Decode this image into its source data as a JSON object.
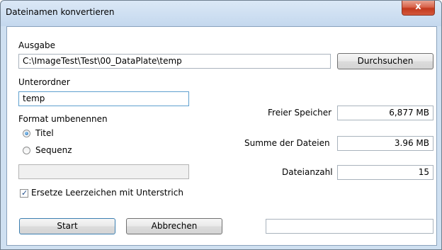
{
  "window": {
    "title": "Dateinamen konvertieren",
    "close_glyph": "x"
  },
  "output": {
    "label": "Ausgabe",
    "path": "C:\\ImageTest\\Test\\00_DataPlate\\temp",
    "browse_label": "Durchsuchen"
  },
  "subfolder": {
    "label": "Unterordner",
    "value": "temp"
  },
  "rename": {
    "label": "Format umbenennen",
    "options": [
      {
        "label": "Titel",
        "selected": true
      },
      {
        "label": "Sequenz",
        "selected": false
      }
    ],
    "sequence_value": ""
  },
  "replace_spaces": {
    "label": "Ersetze Leerzeichen mit Unterstrich",
    "checked": true
  },
  "stats": {
    "free_space_label": "Freier Speicher",
    "free_space_value": "6,877 MB",
    "total_size_label": "Summe der Dateien",
    "total_size_value": "3.96 MB",
    "file_count_label": "Dateianzahl",
    "file_count_value": "15"
  },
  "actions": {
    "start_label": "Start",
    "cancel_label": "Abbrechen"
  },
  "status_field": {
    "value": ""
  }
}
